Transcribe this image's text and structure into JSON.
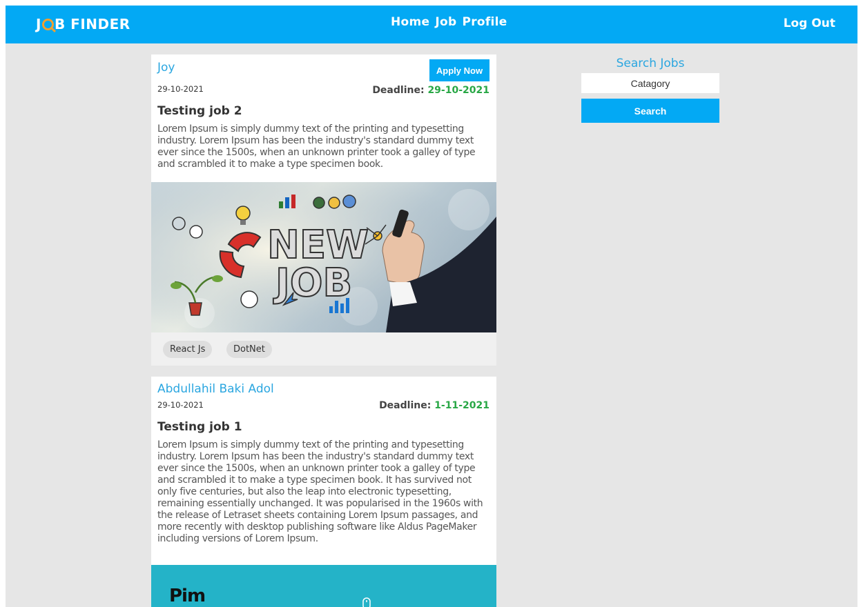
{
  "navbar": {
    "logo_j": "J",
    "logo_rest": "B FINDER",
    "links": [
      "Home",
      "Job",
      "Profile"
    ],
    "logout": "Log Out",
    "color": "#03a9f4"
  },
  "jobs": [
    {
      "poster": "Joy",
      "posted_date": "29-10-2021",
      "deadline_label": "Deadline:",
      "deadline": "29-10-2021",
      "apply_label": "Apply Now",
      "title": "Testing job 2",
      "description": "Lorem Ipsum is simply dummy text of the printing and typesetting industry. Lorem Ipsum has been the industry's standard dummy text ever since the 1500s, when an unknown printer took a galley of type and scrambled it to make a type specimen book.",
      "image_text_1": "NEW",
      "image_text_2": "JOB",
      "tags": [
        "React Js",
        "DotNet"
      ]
    },
    {
      "poster": "Abdullahil Baki Adol",
      "posted_date": "29-10-2021",
      "deadline_label": "Deadline:",
      "deadline": "1-11-2021",
      "title": "Testing job 1",
      "description": "Lorem Ipsum is simply dummy text of the printing and typesetting industry. Lorem Ipsum has been the industry's standard dummy text ever since the 1500s, when an unknown printer took a galley of type and scrambled it to make a type specimen book. It has survived not only five centuries, but also the leap into electronic typesetting, remaining essentially unchanged. It was popularised in the 1960s with the release of Letraset sheets containing Lorem Ipsum passages, and more recently with desktop publishing software like Aldus PageMaker including versions of Lorem Ipsum.",
      "banner_logo": "Pim"
    }
  ],
  "sidebar": {
    "heading": "Search Jobs",
    "placeholder": "Catagory",
    "button": "Search"
  }
}
